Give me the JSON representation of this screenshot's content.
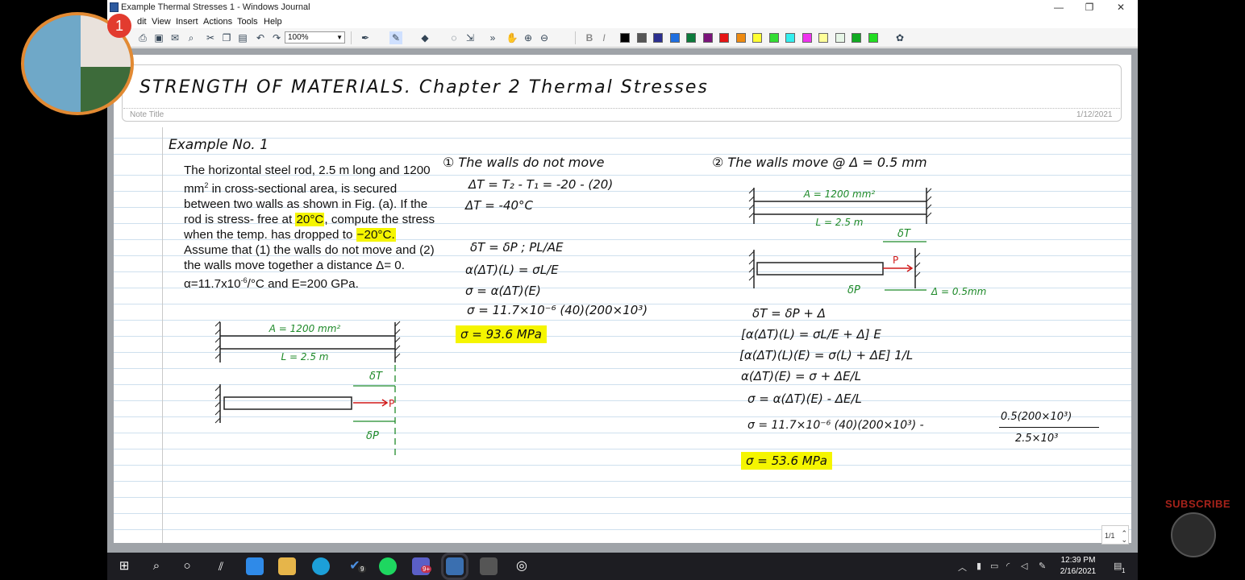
{
  "window": {
    "title": "Example Thermal Stresses 1 - Windows Journal",
    "minimize": "—",
    "restore": "❐",
    "close": "✕"
  },
  "menu": [
    "dit",
    "View",
    "Insert",
    "Actions",
    "Tools",
    "Help"
  ],
  "toolbar": {
    "zoom": "100%",
    "colors": [
      "#000000",
      "#555555",
      "#2b2f8f",
      "#1f6fe0",
      "#0c7a3b",
      "#7a137a",
      "#e51414",
      "#ee8a10",
      "#ffff33",
      "#33dd33",
      "#33eeee",
      "#ee33ee",
      "#ffff99",
      "#e6f5e6",
      "#11aa22",
      "#22dd22"
    ]
  },
  "note": {
    "heading": "STRENGTH OF MATERIALS. Chapter 2 Thermal Stresses",
    "title_label": "Note Title",
    "date": "1/12/2021",
    "page_indicator": "1/1"
  },
  "example": {
    "label": "Example No. 1",
    "p1": "The horizontal steel rod, 2.5 m long and 1200 mm",
    "p2": "in cross-sectional area, is secured between two walls as shown in Fig. (a). If the rod is stress- free at",
    "t1": "20°C",
    "p3": ", compute the stress when the temp. has dropped to",
    "t2": "−20°C.",
    "p4": "Assume that (1) the walls do not move and (2) the walls move together a distance Δ= 0. α=11.7x10",
    "p4b": "/°C and E=200 GPa."
  },
  "fig1": {
    "area": "A = 1200 mm²",
    "length": "L = 2.5 m",
    "dT": "δT",
    "P": "P",
    "dP": "δP"
  },
  "case1": {
    "heading": "① The walls do not move",
    "l1": "ΔT = T₂ - T₁ = -20 - (20)",
    "l2": "ΔT = -40°C",
    "l3": "δT = δP ; PL/AE",
    "l4": "α(ΔT)(L) = σL/E",
    "l5": "σ = α(ΔT)(E)",
    "l6": "σ = 11.7×10⁻⁶ (40)(200×10³)",
    "answer": "σ = 93.6 MPa"
  },
  "case2": {
    "heading": "② The walls move @ Δ = 0.5 mm",
    "area": "A = 1200 mm²",
    "length": "L = 2.5 m",
    "dT": "δT",
    "P": "P",
    "dP": "δP",
    "delta": "Δ = 0.5mm",
    "l1": "δT = δP + Δ",
    "l2": "[α(ΔT)(L) = σL/E + Δ] E",
    "l3": "[α(ΔT)(L)(E) = σ(L) + ΔE] 1/L",
    "l4": "α(ΔT)(E) = σ + ΔE/L",
    "l5": "σ = α(ΔT)(E) - ΔE/L",
    "l6": "σ = 11.7×10⁻⁶ (40)(200×10³) -",
    "frac_num": "0.5(200×10³)",
    "frac_den": "2.5×10³",
    "answer": "σ = 53.6 MPa"
  },
  "taskbar": {
    "time": "12:39 PM",
    "date": "2/16/2021",
    "badge1": "9",
    "badge2": "9+",
    "notif": "1"
  },
  "overlay": {
    "badge": "1",
    "subscribe": "SUBSCRIBE"
  }
}
